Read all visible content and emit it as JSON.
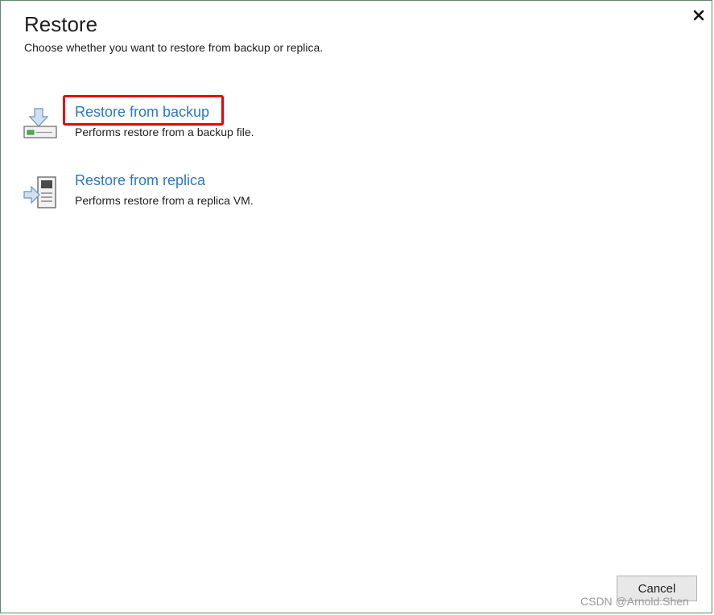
{
  "dialog": {
    "title": "Restore",
    "subtitle": "Choose whether you want to restore from backup or replica."
  },
  "options": [
    {
      "label": "Restore from backup",
      "description": "Performs restore from a backup file.",
      "icon": "restore-backup-icon",
      "highlighted": true
    },
    {
      "label": "Restore from replica",
      "description": "Performs restore from a replica VM.",
      "icon": "restore-replica-icon",
      "highlighted": false
    }
  ],
  "footer": {
    "cancel_label": "Cancel"
  },
  "watermark": "CSDN @Arnold.Shen",
  "colors": {
    "link": "#2b78c2",
    "highlight_border": "#e8000b",
    "icon_green": "#4caf50",
    "icon_blue": "#9fbfe0"
  }
}
